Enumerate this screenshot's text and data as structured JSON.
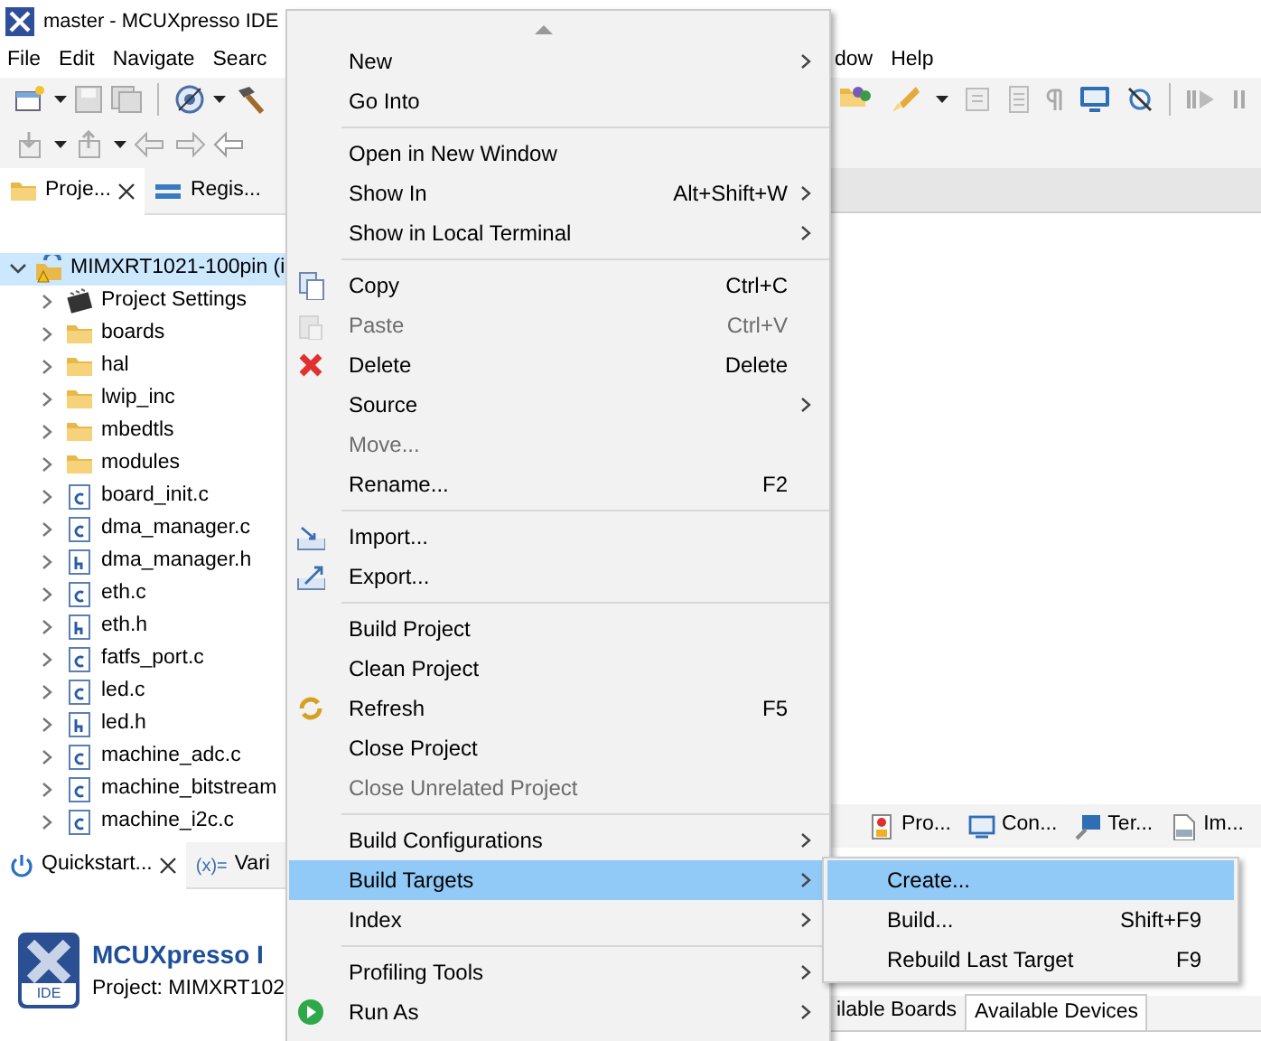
{
  "window": {
    "title": "master - MCUXpresso IDE"
  },
  "menubar": {
    "left": [
      "File",
      "Edit",
      "Navigate",
      "Searc"
    ],
    "right": [
      "dow",
      "Help"
    ]
  },
  "project_explorer": {
    "tabs": [
      {
        "label": "Proje...",
        "selected": true,
        "closable": true
      },
      {
        "label": "Regis...",
        "selected": false,
        "closable": false
      }
    ],
    "tree": {
      "label": "MIMXRT1021-100pin (i",
      "kind": "project",
      "expanded": true,
      "selected": true,
      "children": [
        {
          "label": "Project Settings",
          "kind": "settings",
          "expanded": false,
          "selected": false
        },
        {
          "label": "boards",
          "kind": "folder",
          "expanded": false,
          "selected": false
        },
        {
          "label": "hal",
          "kind": "folder",
          "expanded": false,
          "selected": false
        },
        {
          "label": "lwip_inc",
          "kind": "folder",
          "expanded": false,
          "selected": false
        },
        {
          "label": "mbedtls",
          "kind": "folder",
          "expanded": false,
          "selected": false
        },
        {
          "label": "modules",
          "kind": "folder",
          "expanded": false,
          "selected": false
        },
        {
          "label": "board_init.c",
          "kind": "source",
          "expanded": false,
          "selected": false
        },
        {
          "label": "dma_manager.c",
          "kind": "source",
          "expanded": false,
          "selected": false
        },
        {
          "label": "dma_manager.h",
          "kind": "header",
          "expanded": false,
          "selected": false
        },
        {
          "label": "eth.c",
          "kind": "source",
          "expanded": false,
          "selected": false
        },
        {
          "label": "eth.h",
          "kind": "header",
          "expanded": false,
          "selected": false
        },
        {
          "label": "fatfs_port.c",
          "kind": "source",
          "expanded": false,
          "selected": false
        },
        {
          "label": "led.c",
          "kind": "source",
          "expanded": false,
          "selected": false
        },
        {
          "label": "led.h",
          "kind": "header",
          "expanded": false,
          "selected": false
        },
        {
          "label": "machine_adc.c",
          "kind": "source",
          "expanded": false,
          "selected": false
        },
        {
          "label": "machine_bitstream",
          "kind": "source",
          "expanded": false,
          "selected": false
        },
        {
          "label": "machine_i2c.c",
          "kind": "source",
          "expanded": false,
          "selected": false
        }
      ]
    }
  },
  "quickstart": {
    "tabs": [
      {
        "label": "Quickstart...",
        "selected": true,
        "closable": true
      },
      {
        "label": "Vari",
        "selected": false,
        "closable": false,
        "icon_text": "(x)="
      }
    ],
    "logo_caption": "IDE",
    "title": "MCUXpresso I",
    "subtitle": "Project: MIMXRT102"
  },
  "view_tabs": [
    {
      "label": "Pro..."
    },
    {
      "label": "Con..."
    },
    {
      "label": "Ter..."
    },
    {
      "label": "Im..."
    }
  ],
  "board_tabs": [
    {
      "label": "ilable Boards",
      "selected": false
    },
    {
      "label": "Available Devices",
      "selected": true
    }
  ],
  "context_menu": {
    "items": [
      {
        "kind": "item",
        "label": "New",
        "submenu": true,
        "disabled": false,
        "selected": false
      },
      {
        "kind": "item",
        "label": "Go Into",
        "submenu": false,
        "disabled": false,
        "selected": false
      },
      {
        "kind": "separator"
      },
      {
        "kind": "item",
        "label": "Open in New Window",
        "submenu": false,
        "disabled": false,
        "selected": false
      },
      {
        "kind": "item",
        "label": "Show In",
        "shortcut": "Alt+Shift+W",
        "submenu": true,
        "disabled": false,
        "selected": false
      },
      {
        "kind": "item",
        "label": "Show in Local Terminal",
        "submenu": true,
        "disabled": false,
        "selected": false
      },
      {
        "kind": "separator"
      },
      {
        "kind": "item",
        "label": "Copy",
        "shortcut": "Ctrl+C",
        "submenu": false,
        "disabled": false,
        "selected": false
      },
      {
        "kind": "item",
        "label": "Paste",
        "shortcut": "Ctrl+V",
        "submenu": false,
        "disabled": true,
        "selected": false
      },
      {
        "kind": "item",
        "label": "Delete",
        "shortcut": "Delete",
        "submenu": false,
        "disabled": false,
        "selected": false
      },
      {
        "kind": "item",
        "label": "Source",
        "submenu": true,
        "disabled": false,
        "selected": false
      },
      {
        "kind": "item",
        "label": "Move...",
        "submenu": false,
        "disabled": true,
        "selected": false
      },
      {
        "kind": "item",
        "label": "Rename...",
        "shortcut": "F2",
        "submenu": false,
        "disabled": false,
        "selected": false
      },
      {
        "kind": "separator"
      },
      {
        "kind": "item",
        "label": "Import...",
        "submenu": false,
        "disabled": false,
        "selected": false
      },
      {
        "kind": "item",
        "label": "Export...",
        "submenu": false,
        "disabled": false,
        "selected": false
      },
      {
        "kind": "separator"
      },
      {
        "kind": "item",
        "label": "Build Project",
        "submenu": false,
        "disabled": false,
        "selected": false
      },
      {
        "kind": "item",
        "label": "Clean Project",
        "submenu": false,
        "disabled": false,
        "selected": false
      },
      {
        "kind": "item",
        "label": "Refresh",
        "shortcut": "F5",
        "submenu": false,
        "disabled": false,
        "selected": false
      },
      {
        "kind": "item",
        "label": "Close Project",
        "submenu": false,
        "disabled": false,
        "selected": false
      },
      {
        "kind": "item",
        "label": "Close Unrelated Project",
        "submenu": false,
        "disabled": true,
        "selected": false
      },
      {
        "kind": "separator"
      },
      {
        "kind": "item",
        "label": "Build Configurations",
        "submenu": true,
        "disabled": false,
        "selected": false
      },
      {
        "kind": "item",
        "label": "Build Targets",
        "submenu": true,
        "disabled": false,
        "selected": true
      },
      {
        "kind": "item",
        "label": "Index",
        "submenu": true,
        "disabled": false,
        "selected": false
      },
      {
        "kind": "separator"
      },
      {
        "kind": "item",
        "label": "Profiling Tools",
        "submenu": true,
        "disabled": false,
        "selected": false
      },
      {
        "kind": "item",
        "label": "Run As",
        "submenu": true,
        "disabled": false,
        "selected": false
      }
    ]
  },
  "submenu": {
    "items": [
      {
        "label": "Create...",
        "selected": true
      },
      {
        "label": "Build...",
        "shortcut": "Shift+F9",
        "selected": false
      },
      {
        "label": "Rebuild Last Target",
        "shortcut": "F9",
        "selected": false
      }
    ]
  }
}
